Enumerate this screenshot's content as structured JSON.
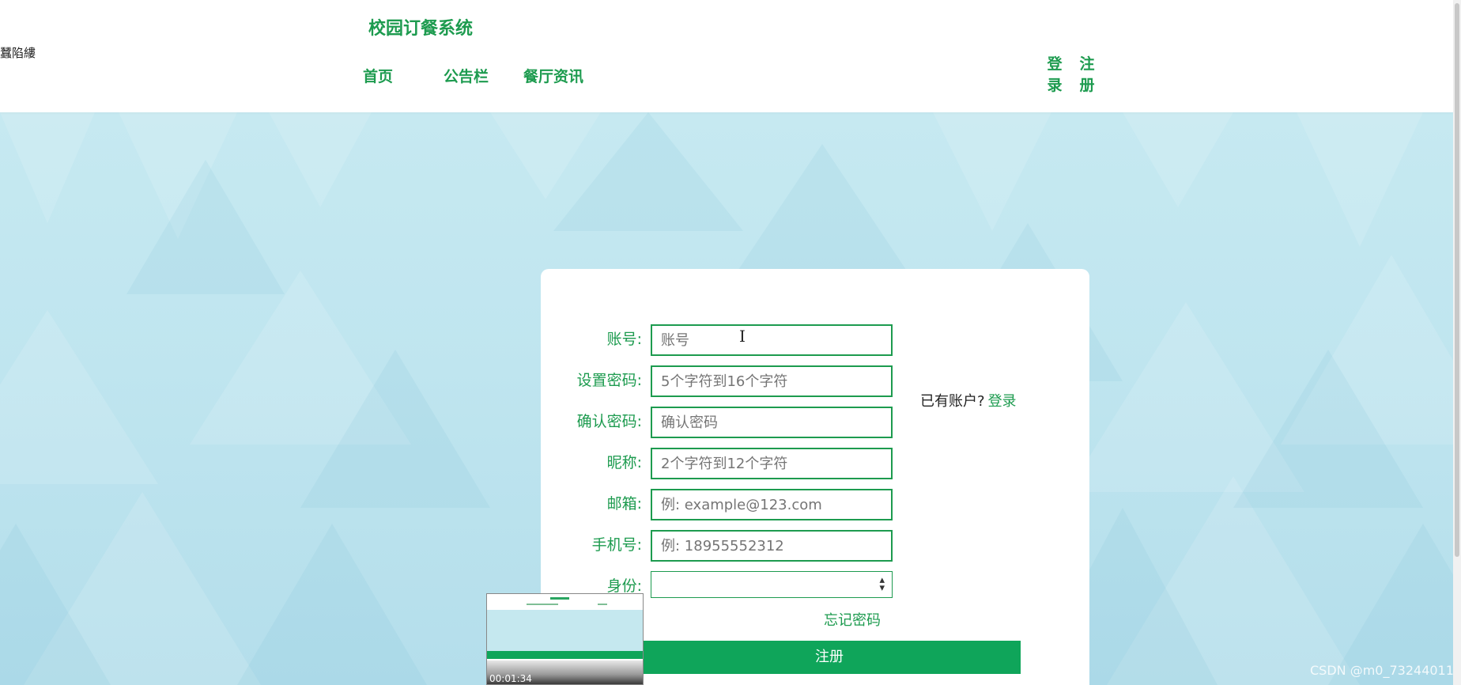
{
  "header": {
    "edge_text": "蠶陷縷",
    "site_title": "校园订餐系统",
    "nav": [
      {
        "label": "首页"
      },
      {
        "label": "公告栏"
      },
      {
        "label": "餐厅资讯"
      }
    ],
    "auth": {
      "login_label": "登录",
      "register_label": "注册"
    }
  },
  "form": {
    "fields": [
      {
        "label": "账号:",
        "value": "",
        "placeholder": "账号"
      },
      {
        "label": "设置密码:",
        "value": "",
        "placeholder": "5个字符到16个字符"
      },
      {
        "label": "确认密码:",
        "value": "",
        "placeholder": "确认密码"
      },
      {
        "label": "昵称:",
        "value": "",
        "placeholder": "2个字符到12个字符"
      },
      {
        "label": "邮箱:",
        "value": "",
        "placeholder": "例: example@123.com"
      },
      {
        "label": "手机号:",
        "value": "",
        "placeholder": "例: 18955552312"
      }
    ],
    "role": {
      "label": "身份:",
      "selected": ""
    },
    "have_account_text": "已有账户?",
    "login_link": "登录",
    "forgot_password": "忘记密码",
    "submit_label": "注册"
  },
  "overlay": {
    "video_time": "00:01:34",
    "watermark": "CSDN @m0_73244011"
  },
  "colors": {
    "accent": "#1d9b4f",
    "button": "#0fa55a",
    "background": "#c3e7f0"
  },
  "icons": {
    "select_arrow": "updown-arrow-icon",
    "cursor": "text-cursor-icon"
  }
}
